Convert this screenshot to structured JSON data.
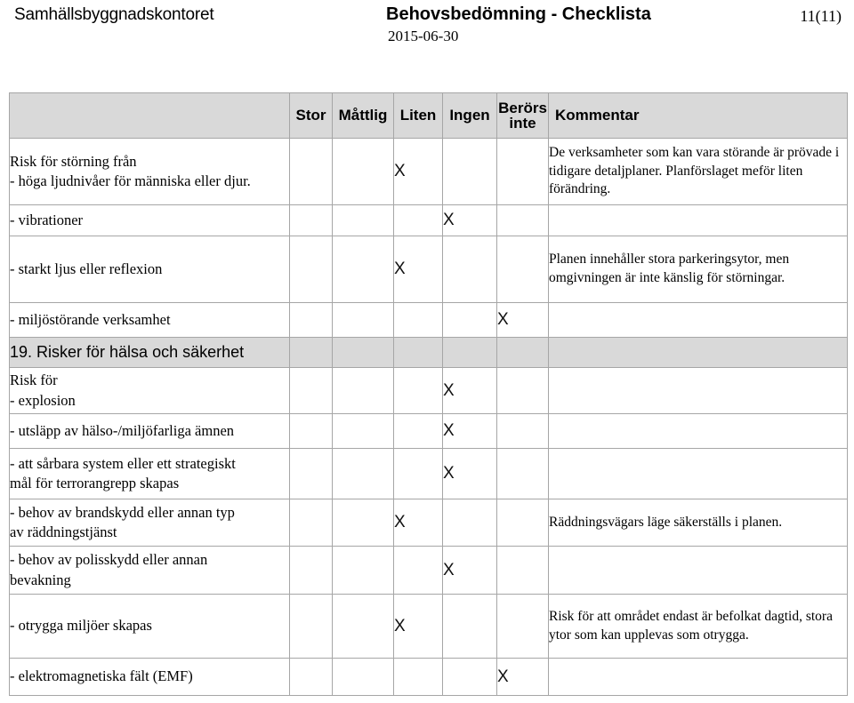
{
  "header": {
    "organization": "Samhällsbyggnadskontoret",
    "title": "Behovsbedömning - Checklista",
    "page_number": "11(11)",
    "date": "2015-06-30"
  },
  "table": {
    "columns": [
      {
        "key": "label",
        "label": ""
      },
      {
        "key": "stor",
        "label": "Stor"
      },
      {
        "key": "mattlig",
        "label": "Måttlig"
      },
      {
        "key": "liten",
        "label": "Liten"
      },
      {
        "key": "ingen",
        "label": "Ingen"
      },
      {
        "key": "berors",
        "label": "Berörs inte"
      },
      {
        "key": "komment",
        "label": "Kommentar"
      }
    ],
    "column_labels": {
      "stor": "Stor",
      "mattlig": "Måttlig",
      "liten": "Liten",
      "ingen": "Ingen",
      "berors_line1": "Berörs",
      "berors_line2": "inte",
      "kommentar": "Kommentar"
    },
    "mark": "X",
    "rows": [
      {
        "label_line1": "Risk för störning från",
        "label_line2": "- höga ljudnivåer för människa eller djur.",
        "stor": "",
        "mattlig": "",
        "liten": "X",
        "ingen": "",
        "berors": "",
        "comment": "De verksamheter som kan vara störande är prövade i tidigare detaljplaner. Planförslaget meför liten förändring."
      },
      {
        "label_line1": "- vibrationer",
        "label_line2": "",
        "stor": "",
        "mattlig": "",
        "liten": "",
        "ingen": "X",
        "berors": "",
        "comment": ""
      },
      {
        "label_line1": "- starkt ljus eller reflexion",
        "label_line2": "",
        "stor": "",
        "mattlig": "",
        "liten": "X",
        "ingen": "",
        "berors": "",
        "comment": "Planen innehåller stora parkeringsytor, men omgivningen är inte känslig för störningar."
      },
      {
        "label_line1": "- miljöstörande verksamhet",
        "label_line2": "",
        "stor": "",
        "mattlig": "",
        "liten": "",
        "ingen": "",
        "berors": "X",
        "comment": ""
      },
      {
        "label_line1": "Risk för",
        "label_line2": "- explosion",
        "stor": "",
        "mattlig": "",
        "liten": "",
        "ingen": "X",
        "berors": "",
        "comment": ""
      },
      {
        "label_line1": "- utsläpp av hälso-/miljöfarliga ämnen",
        "label_line2": "",
        "stor": "",
        "mattlig": "",
        "liten": "",
        "ingen": "X",
        "berors": "",
        "comment": ""
      },
      {
        "label_line1": "- att sårbara system eller ett strategiskt",
        "label_line2": "mål för terrorangrepp skapas",
        "stor": "",
        "mattlig": "",
        "liten": "",
        "ingen": "X",
        "berors": "",
        "comment": ""
      },
      {
        "label_line1": "- behov av brandskydd eller annan typ",
        "label_line2": "av räddningstjänst",
        "stor": "",
        "mattlig": "",
        "liten": "X",
        "ingen": "",
        "berors": "",
        "comment": "Räddningsvägars läge säkerställs i planen."
      },
      {
        "label_line1": "- behov av polisskydd eller annan",
        "label_line2": "bevakning",
        "stor": "",
        "mattlig": "",
        "liten": "",
        "ingen": "X",
        "berors": "",
        "comment": ""
      },
      {
        "label_line1": "- otrygga miljöer skapas",
        "label_line2": "",
        "stor": "",
        "mattlig": "",
        "liten": "X",
        "ingen": "",
        "berors": "",
        "comment": "Risk för att området endast är befolkat dagtid, stora ytor som kan upplevas som otrygga."
      },
      {
        "label_line1": "- elektromagnetiska fält (EMF)",
        "label_line2": "",
        "stor": "",
        "mattlig": "",
        "liten": "",
        "ingen": "",
        "berors": "X",
        "comment": ""
      }
    ],
    "section_header": {
      "label": "19. Risker för hälsa och säkerhet",
      "after_row_index": 3
    }
  },
  "colors": {
    "header_background": "#d9d9d9",
    "border": "#a6a6a6",
    "text": "#000000"
  }
}
